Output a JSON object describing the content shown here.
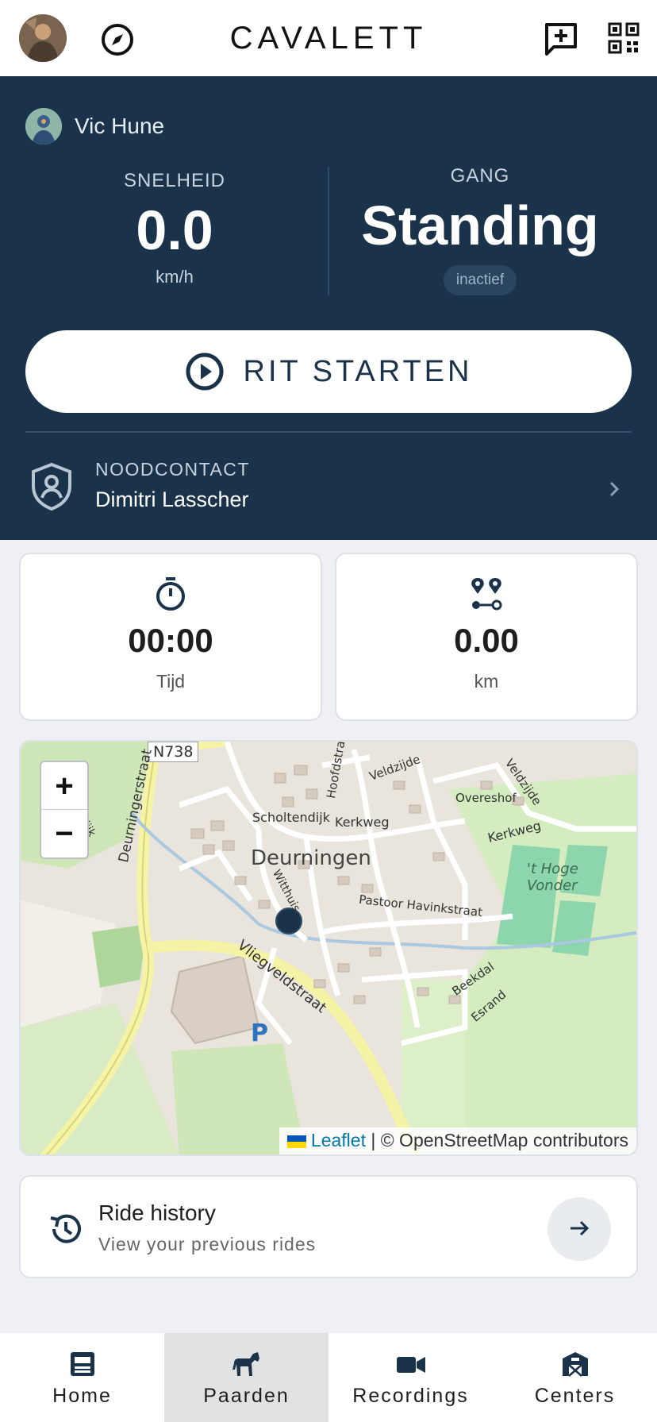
{
  "header": {
    "brand": "CAVALETT",
    "avatar_icon": "user-avatar",
    "left_icon": "compass-icon",
    "right_icons": [
      "message-plus-icon",
      "qr-code-icon"
    ]
  },
  "ride": {
    "rider_name": "Vic Hune",
    "speed_label": "SNELHEID",
    "speed_value": "0.0",
    "speed_unit": "km/h",
    "gait_label": "GANG",
    "gait_value": "Standing",
    "gait_status": "inactief",
    "start_label": "RIT STARTEN"
  },
  "emergency": {
    "label": "NOODCONTACT",
    "name": "Dimitri Lasscher"
  },
  "stats": {
    "time_value": "00:00",
    "time_label": "Tijd",
    "distance_value": "0.00",
    "distance_label": "km"
  },
  "map": {
    "zoom_in": "+",
    "zoom_out": "−",
    "attribution_leaflet": "Leaflet",
    "attribution_rest": "| © OpenStreetMap contributors",
    "labels": {
      "town": "Deurningen",
      "road_n738": "N738",
      "deurningerstraat": "Deurningerstraat",
      "scholtendijk": "Scholtendijk",
      "kerkweg": "Kerkweg",
      "kerkweg2": "Kerkweg",
      "hoofdstraat": "Hoofdstraat",
      "veldzijde": "Veldzijde",
      "veldzijde2": "Veldzijde",
      "overeshof": "Overeshof",
      "hoge_vonder": "'t Hoge Vonder",
      "pastoor": "Pastoor Havinkstraat",
      "vliegveldstraat": "Vliegveldstraat",
      "beekdal": "Beekdal",
      "esrand": "Esrand",
      "witthuis": "Witthuis",
      "parking": "P",
      "dijk": "dijk"
    }
  },
  "history": {
    "title": "Ride history",
    "subtitle": "View your previous rides"
  },
  "nav": {
    "home": "Home",
    "paarden": "Paarden",
    "recordings": "Recordings",
    "centers": "Centers",
    "active": "paarden"
  }
}
